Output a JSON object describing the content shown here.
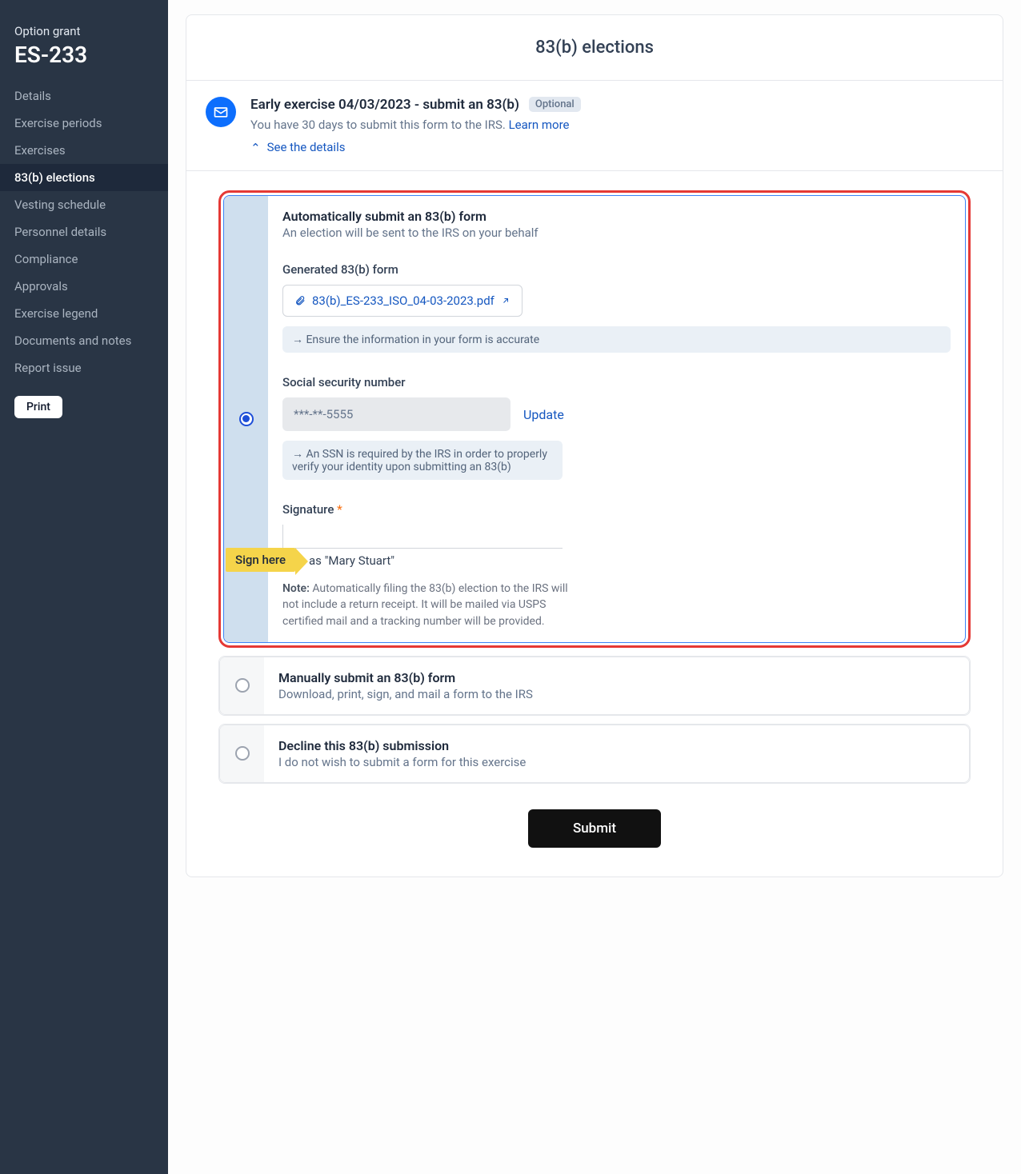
{
  "sidebar": {
    "subtitle": "Option grant",
    "title": "ES-233",
    "items": [
      {
        "label": "Details"
      },
      {
        "label": "Exercise periods"
      },
      {
        "label": "Exercises"
      },
      {
        "label": "83(b) elections",
        "active": true
      },
      {
        "label": "Vesting schedule"
      },
      {
        "label": "Personnel details"
      },
      {
        "label": "Compliance"
      },
      {
        "label": "Approvals"
      },
      {
        "label": "Exercise legend"
      },
      {
        "label": "Documents and notes"
      },
      {
        "label": "Report issue"
      }
    ],
    "print": "Print"
  },
  "header": "83(b) elections",
  "notice": {
    "title": "Early exercise 04/03/2023 - submit an 83(b)",
    "pill": "Optional",
    "body": "You have 30 days to submit this form to the IRS.",
    "learn": "Learn more",
    "details": "See the details"
  },
  "auto": {
    "title": "Automatically submit an 83(b) form",
    "sub": "An election will be sent to the IRS on your behalf",
    "genLabel": "Generated 83(b) form",
    "file": "83(b)_ES-233_ISO_04-03-2023.pdf",
    "hint1": "→ Ensure the information in your form is accurate",
    "ssnLabel": "Social security number",
    "ssnValue": "***-**-5555",
    "update": "Update",
    "hint2": "→ An SSN is required by the IRS in order to properly verify your identity upon submitting an 83(b)",
    "sigLabel": "Signature",
    "signAs": "Sign as \"Mary Stuart\"",
    "noteBold": "Note:",
    "note": " Automatically filing the 83(b) election to the IRS will not include a return receipt. It will be mailed via USPS certified mail and a tracking number will be provided.",
    "tag": "Sign here"
  },
  "manual": {
    "title": "Manually submit an 83(b) form",
    "sub": "Download, print, sign, and mail a form to the IRS"
  },
  "decline": {
    "title": "Decline this 83(b) submission",
    "sub": "I do not wish to submit a form for this exercise"
  },
  "submit": "Submit"
}
